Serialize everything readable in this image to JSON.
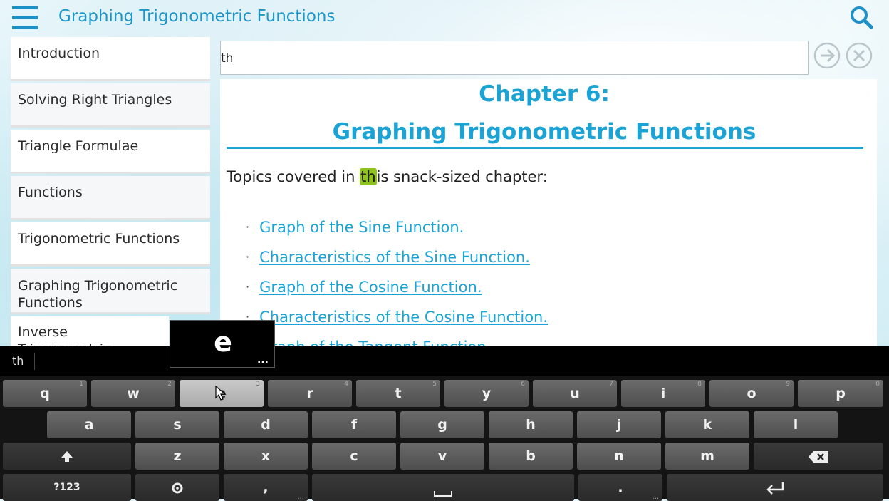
{
  "header": {
    "title": "Graphing Trigonometric Functions"
  },
  "sidebar": {
    "items": [
      {
        "label": "Introduction"
      },
      {
        "label": "Solving Right Triangles"
      },
      {
        "label": "Triangle Formulae"
      },
      {
        "label": "Functions"
      },
      {
        "label": "Trigonometric Functions"
      },
      {
        "label": "Graphing Trigonometric Functions"
      },
      {
        "label": "Inverse Trigonometric Functions"
      }
    ]
  },
  "find": {
    "value": "th"
  },
  "content": {
    "chapter": "Chapter 6:",
    "chapter_title": "Graphing Trigonometric Functions",
    "intro_before": "Topics covered in ",
    "intro_match": "th",
    "intro_after": "is snack-sized chapter:",
    "bullet": "·",
    "topics": [
      {
        "label": "Graph of the Sine Function."
      },
      {
        "label": "Characteristics of the Sine Function."
      },
      {
        "label": "Graph of the Cosine Function."
      },
      {
        "label": "Characteristics of the Cosine Function."
      },
      {
        "label": "Graph of the Tangent Function."
      }
    ]
  },
  "key_preview": {
    "char": "e",
    "more": "..."
  },
  "keyboard": {
    "suggestion": "th",
    "row1": [
      {
        "label": "q",
        "hint": "1"
      },
      {
        "label": "w",
        "hint": "2"
      },
      {
        "label": "e",
        "hint": "3"
      },
      {
        "label": "r",
        "hint": "4"
      },
      {
        "label": "t",
        "hint": "5"
      },
      {
        "label": "y",
        "hint": "6"
      },
      {
        "label": "u",
        "hint": "7"
      },
      {
        "label": "i",
        "hint": "8"
      },
      {
        "label": "o",
        "hint": "9"
      },
      {
        "label": "p",
        "hint": "0"
      }
    ],
    "row2": [
      "a",
      "s",
      "d",
      "f",
      "g",
      "h",
      "j",
      "k",
      "l"
    ],
    "row3": [
      "z",
      "x",
      "c",
      "v",
      "b",
      "n",
      "m"
    ],
    "symbols_label": "?123",
    "comma": ",",
    "period": ".",
    "dots": "..."
  },
  "colors": {
    "accent": "#1ca3d6",
    "highlight": "#8dc21f",
    "keyboard_bg": "#141414"
  }
}
